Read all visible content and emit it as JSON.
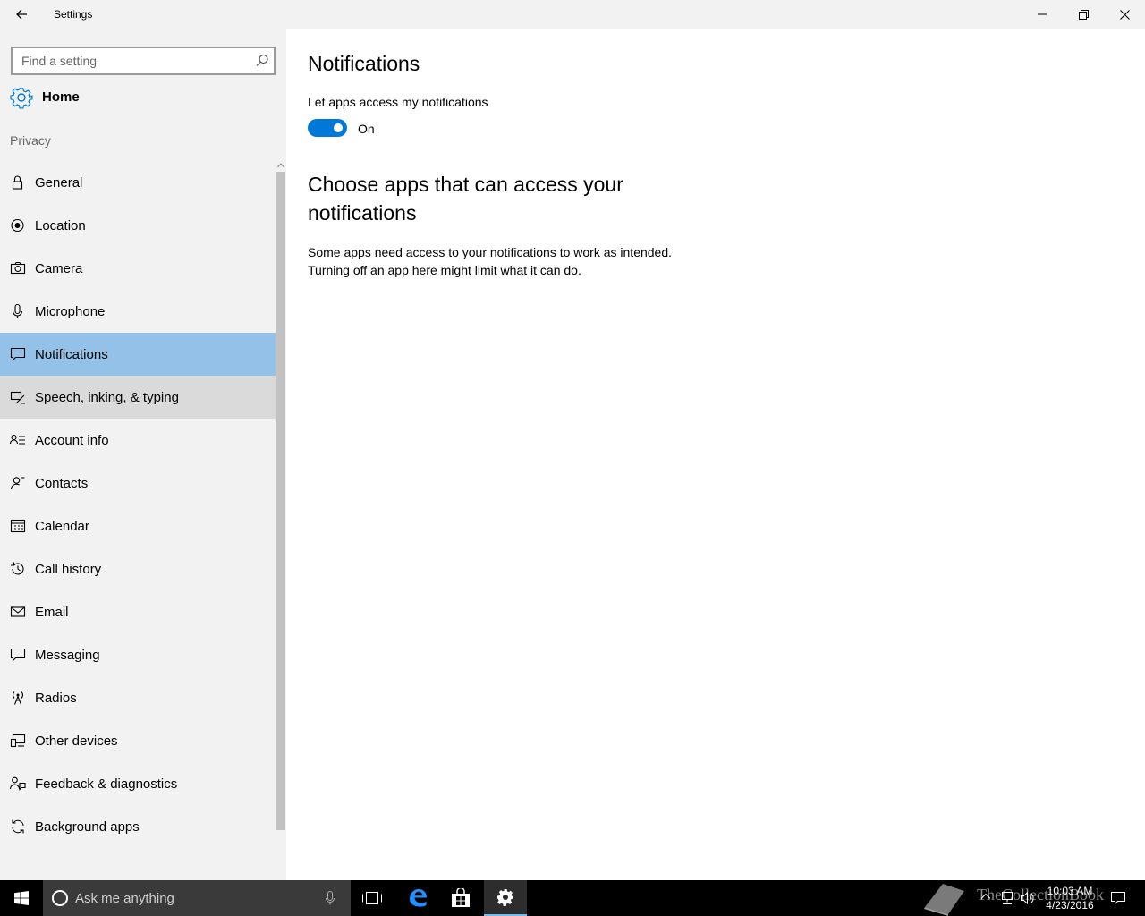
{
  "window": {
    "title": "Settings"
  },
  "sidebar": {
    "search_placeholder": "Find a setting",
    "home_label": "Home",
    "section_label": "Privacy",
    "items": [
      {
        "label": "General",
        "icon": "lock-icon"
      },
      {
        "label": "Location",
        "icon": "location-icon"
      },
      {
        "label": "Camera",
        "icon": "camera-icon"
      },
      {
        "label": "Microphone",
        "icon": "microphone-icon"
      },
      {
        "label": "Notifications",
        "icon": "notifications-icon",
        "state": "selected"
      },
      {
        "label": "Speech, inking, & typing",
        "icon": "speech-icon",
        "state": "hover"
      },
      {
        "label": "Account info",
        "icon": "account-info-icon"
      },
      {
        "label": "Contacts",
        "icon": "contacts-icon"
      },
      {
        "label": "Calendar",
        "icon": "calendar-icon"
      },
      {
        "label": "Call history",
        "icon": "history-icon"
      },
      {
        "label": "Email",
        "icon": "email-icon"
      },
      {
        "label": "Messaging",
        "icon": "messaging-icon"
      },
      {
        "label": "Radios",
        "icon": "radio-icon"
      },
      {
        "label": "Other devices",
        "icon": "devices-icon"
      },
      {
        "label": "Feedback & diagnostics",
        "icon": "feedback-icon"
      },
      {
        "label": "Background apps",
        "icon": "background-apps-icon"
      }
    ]
  },
  "main": {
    "title": "Notifications",
    "setting_label": "Let apps access my notifications",
    "toggle_state": "On",
    "subtitle": "Choose apps that can access your notifications",
    "description_line1": "Some apps need access to your notifications to work as intended.",
    "description_line2": "Turning off an app here might limit what it can do."
  },
  "taskbar": {
    "search_placeholder": "Ask me anything",
    "watermark": "TheCollectionBook",
    "time": "10:03 AM",
    "date": "4/23/2016"
  },
  "colors": {
    "accent": "#0078d7",
    "selected": "#93c1e8",
    "hover": "#dadada",
    "sidebar_bg": "#f2f2f2"
  }
}
